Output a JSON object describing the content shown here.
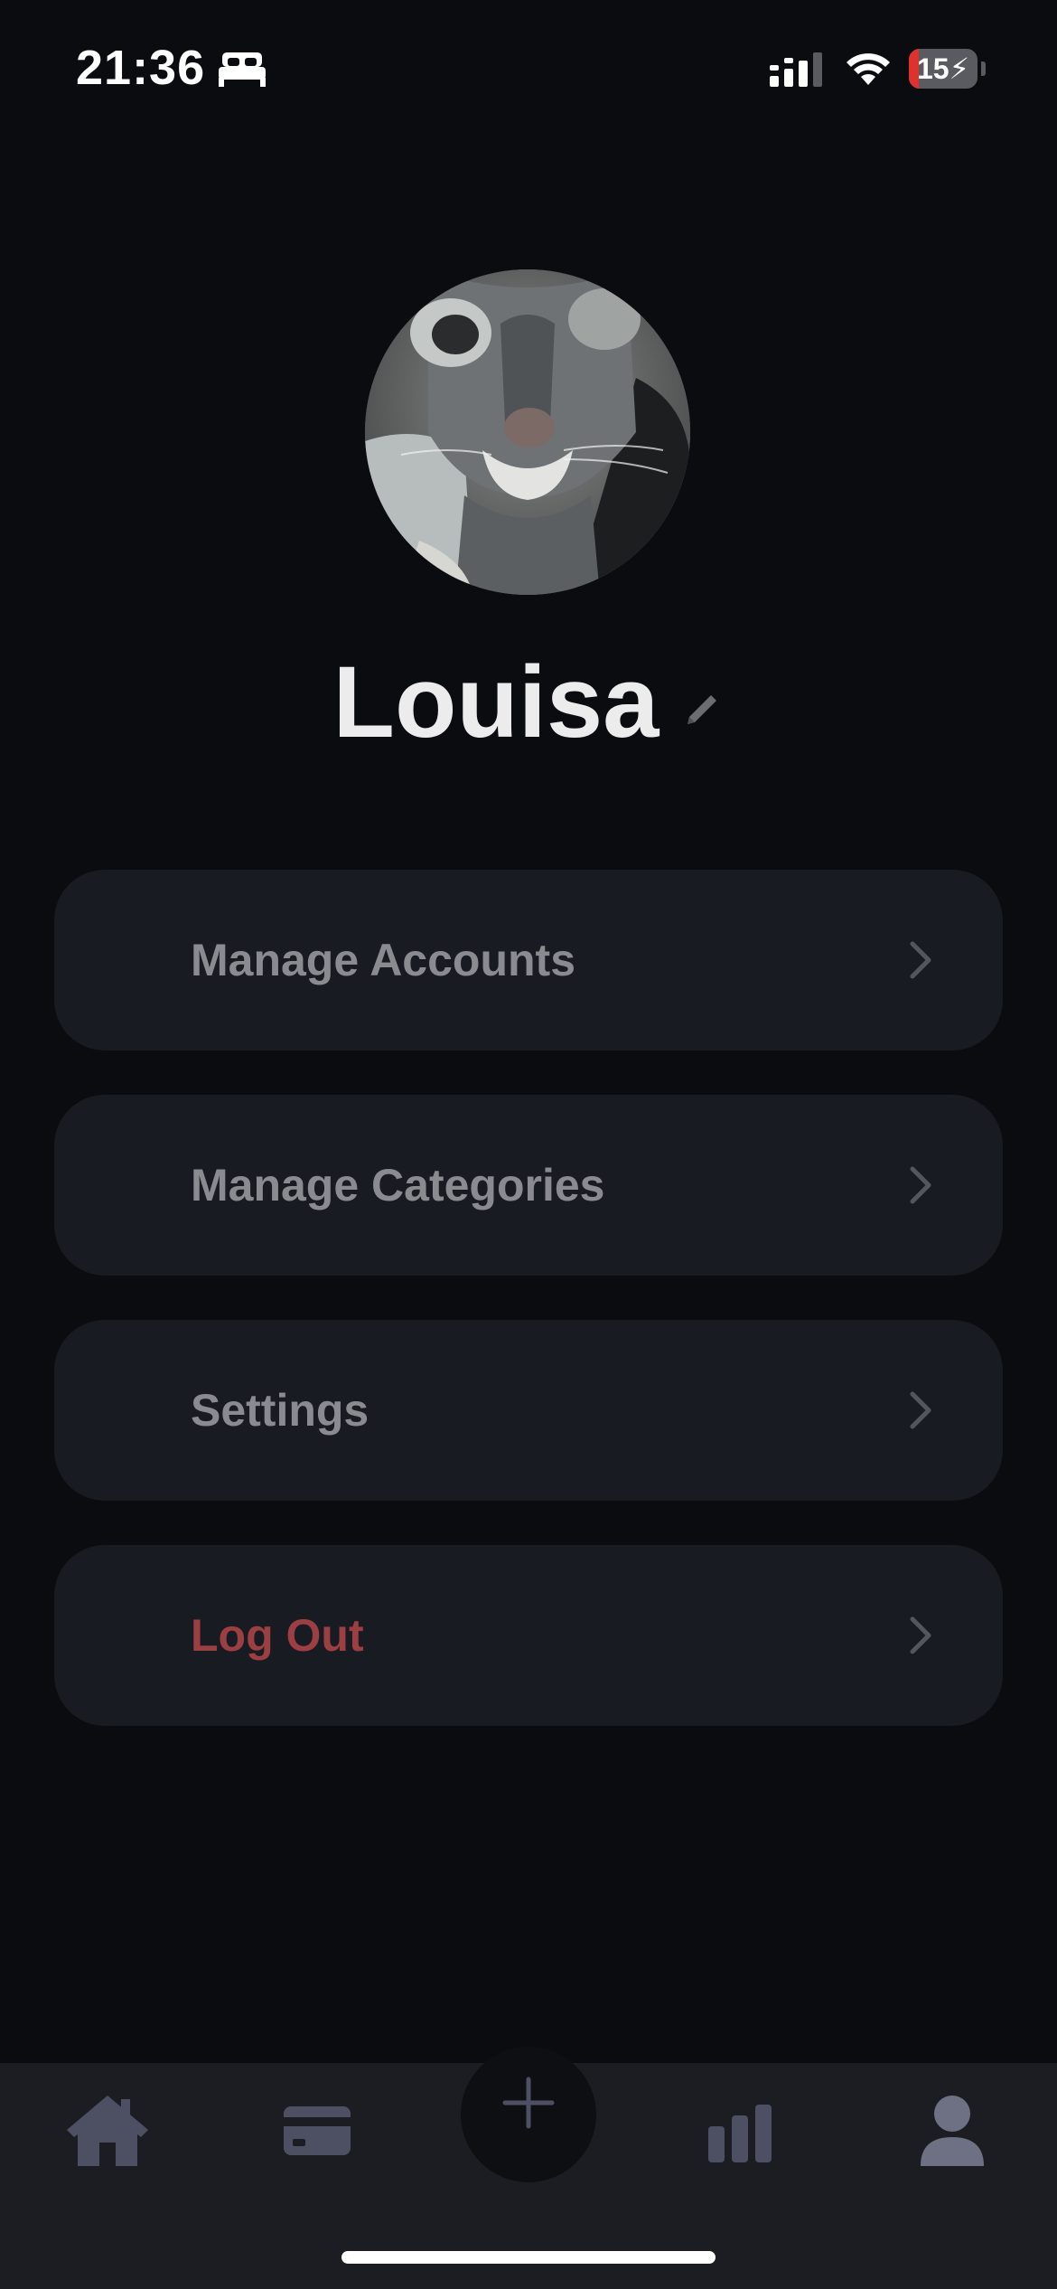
{
  "status_bar": {
    "time": "21:36",
    "battery_text": "15",
    "battery_level": 0.15
  },
  "profile": {
    "name": "Louisa",
    "avatar_icon": "cat-photo-avatar",
    "edit_icon": "pencil-icon"
  },
  "menu": {
    "items": [
      {
        "label": "Manage Accounts",
        "icon": "chevron-right-icon"
      },
      {
        "label": "Manage Categories",
        "icon": "chevron-right-icon"
      },
      {
        "label": "Settings",
        "icon": "chevron-right-icon"
      },
      {
        "label": "Log Out",
        "icon": "chevron-right-icon"
      }
    ]
  },
  "tab_bar": {
    "tabs": [
      {
        "icon": "home-icon"
      },
      {
        "icon": "card-icon"
      },
      {
        "icon": "plus-icon"
      },
      {
        "icon": "bar-chart-icon"
      },
      {
        "icon": "profile-icon",
        "active": true
      }
    ]
  },
  "colors": {
    "background": "#0b0c10",
    "card": "#191b22",
    "label": "#8a8b90",
    "danger": "#9b3f42",
    "tab_icon": "#4d5062",
    "tab_icon_active": "#6e7184"
  }
}
